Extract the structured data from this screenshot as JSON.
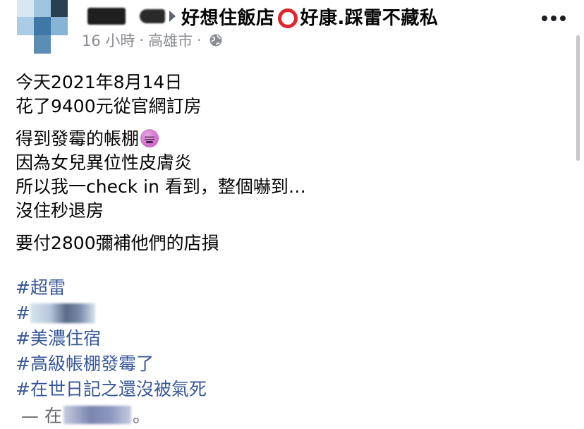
{
  "post": {
    "author_name_hidden": true,
    "page_name_part1": "好想住飯店",
    "page_name_part2": "好康.踩雷不藏私",
    "meta": {
      "time": "16 小時",
      "sep1": "·",
      "location": "高雄市",
      "sep2": "·",
      "audience_icon": "globe-icon"
    },
    "more_icon": "more-options-icon",
    "paragraphs": [
      [
        "今天2021年8月14日",
        "花了9400元從官網訂房"
      ],
      [
        "得到發霉的帳棚",
        "因為女兒異位性皮膚炎",
        "所以我一check in 看到，整個嚇到…",
        "沒住秒退房"
      ],
      [
        "要付2800彌補他們的店損"
      ]
    ],
    "emoji_name": "confounded-face-emoji",
    "hashtags": {
      "tag1": "#超雷",
      "tag2_visible_prefix": "#",
      "tag3": "#美濃住宿",
      "tag4": "#高級帳棚發霉了",
      "tag5": "#在世日記之還沒被氣死"
    },
    "location_line": {
      "prefix": "— 在",
      "suffix": "。"
    }
  },
  "colors": {
    "text": "#050505",
    "meta": "#8a8d91",
    "hashtag": "#385898",
    "ring": "#e0262d"
  }
}
